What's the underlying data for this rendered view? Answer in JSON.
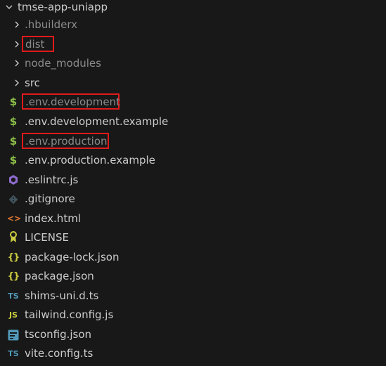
{
  "root": {
    "name": "tmse-app-uniapp"
  },
  "folders": [
    {
      "name": ".hbuilderx"
    },
    {
      "name": "dist"
    },
    {
      "name": "node_modules"
    },
    {
      "name": "src"
    }
  ],
  "files": [
    {
      "name": ".env.development",
      "icon": "dollar-icon"
    },
    {
      "name": ".env.development.example",
      "icon": "dollar-icon"
    },
    {
      "name": ".env.production",
      "icon": "dollar-icon"
    },
    {
      "name": ".env.production.example",
      "icon": "dollar-icon"
    },
    {
      "name": ".eslintrc.js",
      "icon": "eslint-icon"
    },
    {
      "name": ".gitignore",
      "icon": "git-icon"
    },
    {
      "name": "index.html",
      "icon": "html-icon"
    },
    {
      "name": "LICENSE",
      "icon": "license-icon"
    },
    {
      "name": "package-lock.json",
      "icon": "json-braces-icon"
    },
    {
      "name": "package.json",
      "icon": "json-braces-icon"
    },
    {
      "name": "shims-uni.d.ts",
      "icon": "typescript-icon"
    },
    {
      "name": "tailwind.config.js",
      "icon": "javascript-icon"
    },
    {
      "name": "tsconfig.json",
      "icon": "tsconfig-icon"
    },
    {
      "name": "vite.config.ts",
      "icon": "typescript-icon"
    }
  ],
  "icon_glyphs": {
    "dollar": "$",
    "braces": "{}",
    "ts": "TS",
    "js": "JS",
    "html": "<>"
  },
  "colors": {
    "background": "#181818",
    "text": "#cccccc",
    "dimmed_text": "#8b8b8b",
    "highlight_box": "#e01b1b",
    "env_icon": "#8dc149",
    "json_icon": "#cbcb41",
    "ts_icon": "#519aba",
    "eslint_icon": "#8e6ccf",
    "html_icon": "#e37933",
    "license_icon": "#cbcb41",
    "git_icon": "#41535b"
  }
}
